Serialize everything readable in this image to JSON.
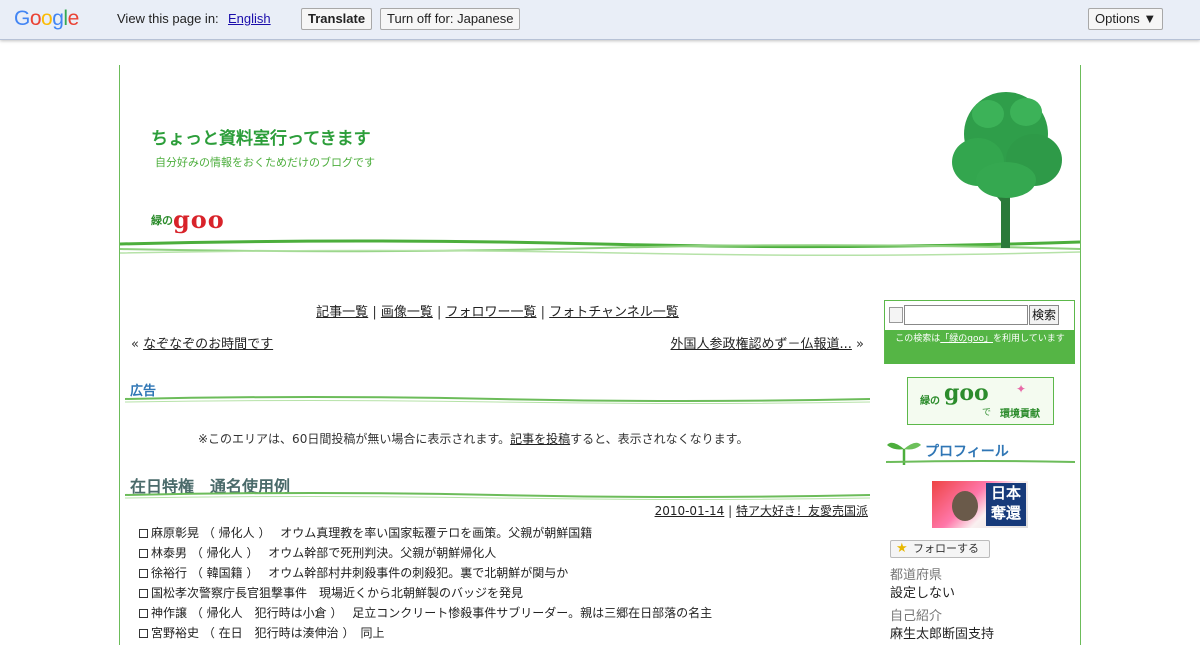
{
  "translate_bar": {
    "logo_letters": [
      {
        "ch": "G",
        "color": "#4285f4"
      },
      {
        "ch": "o",
        "color": "#ea4335"
      },
      {
        "ch": "o",
        "color": "#fbbc05"
      },
      {
        "ch": "g",
        "color": "#4285f4"
      },
      {
        "ch": "l",
        "color": "#34a853"
      },
      {
        "ch": "e",
        "color": "#ea4335"
      }
    ],
    "prompt": "View this page in:",
    "language_link": "English",
    "translate_label": "Translate",
    "turn_off_label": "Turn off for: Japanese",
    "options_label": "Options ▼"
  },
  "blog": {
    "title": "ちょっと資料室行ってきます",
    "description": "自分好みの情報をおくためだけのブログです",
    "logo_midori": "緑の",
    "logo_goo": "goo"
  },
  "nav": {
    "links": [
      "記事一覧",
      "画像一覧",
      "フォロワー一覧",
      "フォトチャンネル一覧"
    ],
    "separator": " | ",
    "prev_arrow": "« ",
    "prev_label": "なぞなぞのお時間です",
    "next_label": "外国人参政権認めず－仏報道...",
    "next_arrow": " »"
  },
  "ad": {
    "heading": "広告",
    "text_before": "※このエリアは、60日間投稿が無い場合に表示されます。",
    "link": "記事を投稿",
    "text_after": "すると、表示されなくなります。"
  },
  "post": {
    "title": "在日特権　通名使用例",
    "date": "2010-01-14",
    "meta_sep": " | ",
    "category": "特ア大好き！友愛売国派",
    "lines": [
      "麻原彰晃 （ 帰化人 ）　 オウム真理教を率い国家転覆テロを画策。父親が朝鮮国籍",
      "林泰男 （ 帰化人 ）　 オウム幹部で死刑判決。父親が朝鮮帰化人",
      "徐裕行 （ 韓国籍 ）　 オウム幹部村井刺殺事件の刺殺犯。裏で北朝鮮が関与か",
      "国松孝次警察庁長官狙撃事件　現場近くから北朝鮮製のバッジを発見",
      "神作譲 （ 帰化人　犯行時は小倉 ）　 足立コンクリート惨殺事件サブリーダー。親は三郷在日部落の名主",
      "宮野裕史 （ 在日　犯行時は湊伸治 ）　同上"
    ]
  },
  "sidebar": {
    "search_button": "検索",
    "search_note_before": "この検索は",
    "search_note_link": "「緑のgoo」",
    "search_note_after": "を利用しています",
    "banner_midori": "緑の",
    "banner_goo": "goo",
    "banner_de": "で",
    "banner_kankyo": "環境貢献",
    "profile_heading": "プロフィール",
    "avatar_text": "日本奪還",
    "follow_label": "フォローする",
    "fields": [
      {
        "label": "都道府県",
        "value": "設定しない"
      },
      {
        "label": "自己紹介",
        "value": "麻生太郎断固支持"
      }
    ]
  },
  "colors": {
    "accent_green": "#2c9e3a",
    "heading_blue": "#2f76b5",
    "goo_red": "#d8232a"
  }
}
